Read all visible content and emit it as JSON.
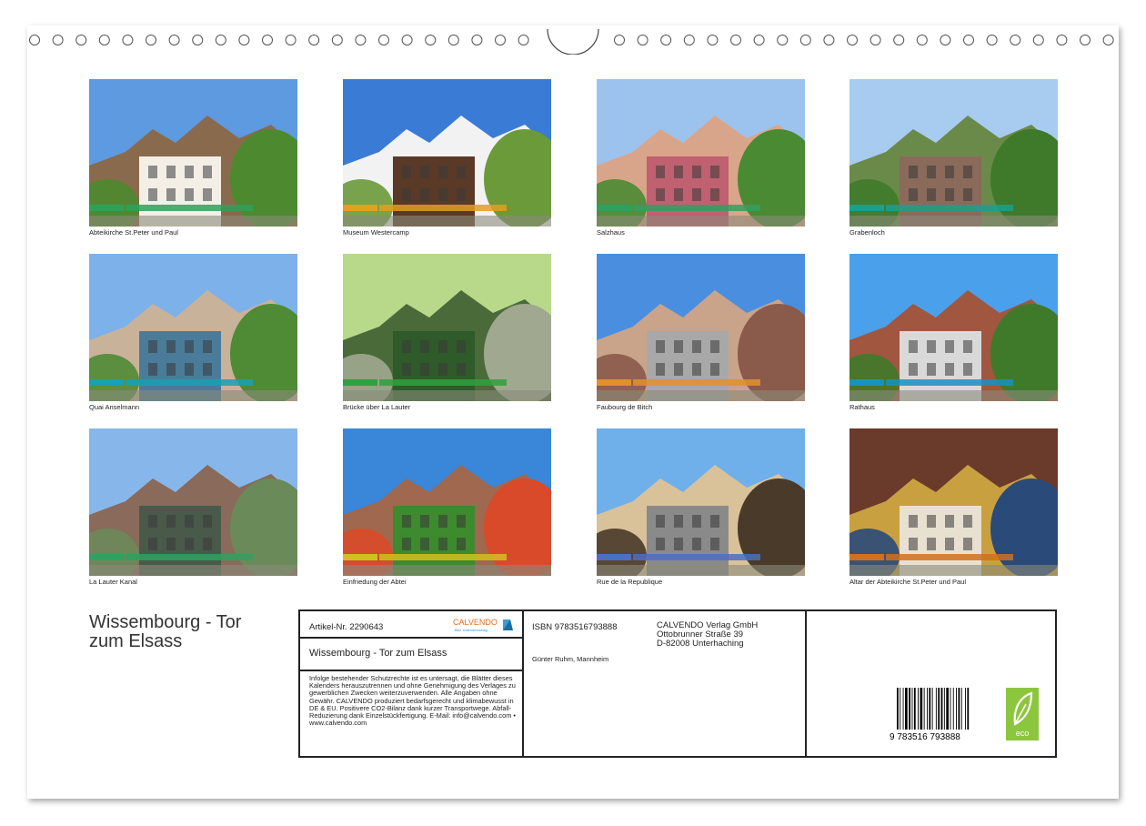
{
  "calendar": {
    "title_line1": "Wissembourg - Tor",
    "title_line2": "zum Elsass"
  },
  "photos": [
    {
      "caption": "Abteikirche St.Peter und Paul",
      "icon": "church-photo"
    },
    {
      "caption": "Museum Westercamp",
      "icon": "half-timbered-house-photo"
    },
    {
      "caption": "Salzhaus",
      "icon": "salt-house-photo"
    },
    {
      "caption": "Grabenloch",
      "icon": "city-wall-photo"
    },
    {
      "caption": "Quai Anselmann",
      "icon": "canal-photo"
    },
    {
      "caption": "Brücke über La Lauter",
      "icon": "bridge-photo"
    },
    {
      "caption": "Faubourg de Bitch",
      "icon": "street-photo"
    },
    {
      "caption": "Rathaus",
      "icon": "town-hall-photo"
    },
    {
      "caption": "La Lauter Kanal",
      "icon": "river-channel-photo"
    },
    {
      "caption": "Einfriedung der Abtei",
      "icon": "abbey-wall-photo"
    },
    {
      "caption": "Rue de la Republique",
      "icon": "old-town-street-photo"
    },
    {
      "caption": "Altar der Abteikirche St.Peter und Paul",
      "icon": "altar-photo"
    }
  ],
  "info": {
    "article_no": "Artikel-Nr. 2290643",
    "brand": "CALVENDO",
    "brand_tagline": "Bild. Kalenderverlag",
    "product_title": "Wissembourg - Tor zum Elsass",
    "legal_text": "Infolge bestehender Schutzrechte ist es untersagt, die Blätter dieses Kalenders herauszutrennen und ohne Genehmigung des Verlages zu gewerblichen Zwecken weiterzuverwenden. Alle Angaben ohne Gewähr. CALVENDO produziert bedarfsgerecht und klimabewusst in DE & EU. Positivere CO2-Bilanz dank kurzer Transportwege. Abfall-Reduzierung dank Einzelstückfertigung. E-Mail: info@calvendo.com • www.calvendo.com",
    "isbn": "ISBN 9783516793888",
    "author": "Günter Ruhm, Mannheim",
    "publisher_name": "CALVENDO Verlag GmbH",
    "publisher_street": "Ottobrunner Straße 39",
    "publisher_city": "D-82008 Unterhaching",
    "barcode_digits": "9 783516 793888",
    "eco_label": "eco"
  },
  "colors": {
    "border": "#222222",
    "eco_green": "#8cc63f",
    "sky": "#4a8fd6"
  }
}
